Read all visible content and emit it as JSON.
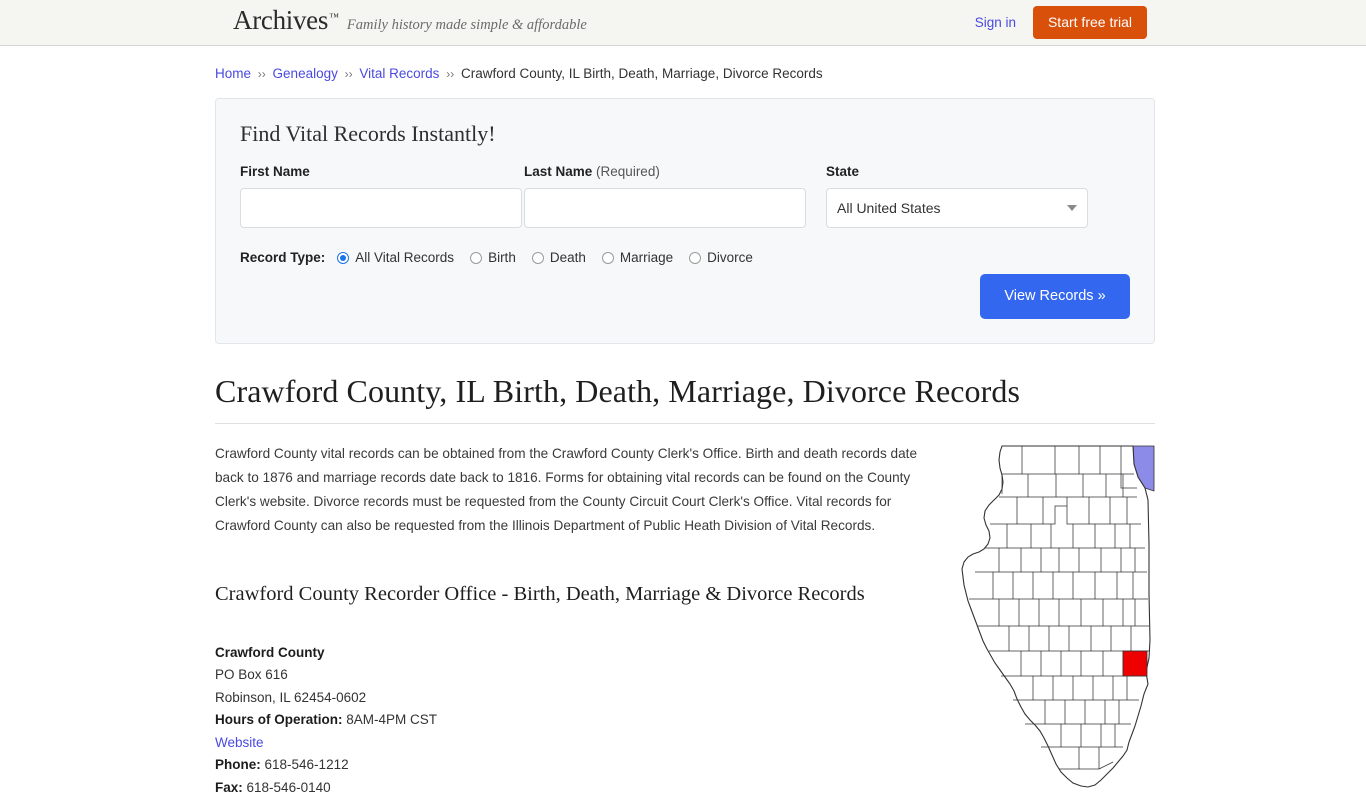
{
  "header": {
    "brand_name": "Archives",
    "brand_tm": "™",
    "tagline": "Family history made simple & affordable",
    "sign_in": "Sign in",
    "start_trial": "Start free trial"
  },
  "breadcrumb": {
    "items": [
      {
        "label": "Home",
        "link": true
      },
      {
        "label": "Genealogy",
        "link": true
      },
      {
        "label": "Vital Records",
        "link": true
      },
      {
        "label": "Crawford County, IL Birth, Death, Marriage, Divorce Records",
        "link": false
      }
    ],
    "separator": "››"
  },
  "search_form": {
    "title": "Find Vital Records Instantly!",
    "first_name": {
      "label": "First Name",
      "value": "",
      "placeholder": ""
    },
    "last_name": {
      "label": "Last Name",
      "required_note": "(Required)",
      "value": "",
      "placeholder": ""
    },
    "state": {
      "label": "State",
      "selected": "All United States"
    },
    "record_type": {
      "label": "Record Type:",
      "options": [
        {
          "label": "All Vital Records",
          "checked": true
        },
        {
          "label": "Birth",
          "checked": false
        },
        {
          "label": "Death",
          "checked": false
        },
        {
          "label": "Marriage",
          "checked": false
        },
        {
          "label": "Divorce",
          "checked": false
        }
      ]
    },
    "submit_label": "View Records »"
  },
  "main": {
    "title": "Crawford County, IL Birth, Death, Marriage, Divorce Records",
    "intro": "Crawford County vital records can be obtained from the Crawford County Clerk's Office. Birth and death records date back to 1876 and marriage records date back to 1816. Forms for obtaining vital records can be found on the County Clerk's website. Divorce records must be requested from the County Circuit Court Clerk's Office. Vital records for Crawford County can also be requested from the Illinois Department of Public Heath Division of Vital Records.",
    "subheading": "Crawford County Recorder Office - Birth, Death, Marriage & Divorce Records",
    "office": {
      "name": "Crawford County",
      "address_line1": "PO Box 616",
      "address_line2": "Robinson, IL 62454-0602",
      "hours_label": "Hours of Operation:",
      "hours_value": "8AM-4PM CST",
      "website_label": "Website",
      "phone_label": "Phone:",
      "phone_value": "618-546-1212",
      "fax_label": "Fax:",
      "fax_value": "618-546-0140"
    }
  },
  "map": {
    "alt": "Map of Illinois counties with Crawford County highlighted",
    "highlight_county": "Crawford",
    "highlight_color": "#ee0000",
    "water_color": "#8c8ce8",
    "land_color": "#ffffff",
    "border_color": "#333333"
  },
  "colors": {
    "accent_orange": "#d9500b",
    "accent_blue": "#3367f0",
    "link_blue": "#4a4ae0",
    "panel_bg": "#f6f8fa",
    "header_bg": "#f5f5f1"
  }
}
